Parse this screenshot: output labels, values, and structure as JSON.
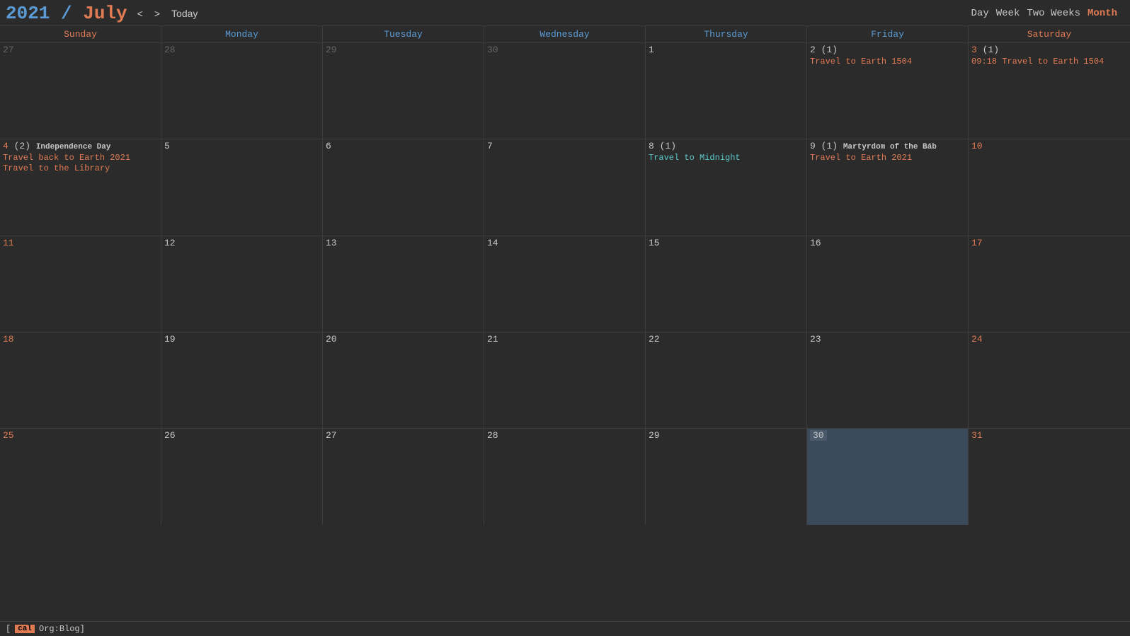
{
  "header": {
    "year": "2021",
    "sep": " / ",
    "month": "July",
    "nav": {
      "prev": "<",
      "next": ">",
      "today": "Today"
    },
    "views": [
      "Day",
      "Week",
      "Two Weeks",
      "Month"
    ],
    "active_view": "Month"
  },
  "day_headers": [
    {
      "label": "Sunday",
      "type": "weekend"
    },
    {
      "label": "Monday",
      "type": "weekday"
    },
    {
      "label": "Tuesday",
      "type": "weekday"
    },
    {
      "label": "Wednesday",
      "type": "weekday"
    },
    {
      "label": "Thursday",
      "type": "weekday"
    },
    {
      "label": "Friday",
      "type": "weekday"
    },
    {
      "label": "Saturday",
      "type": "weekend"
    }
  ],
  "weeks": [
    {
      "days": [
        {
          "date": "27",
          "type": "other-month",
          "events": []
        },
        {
          "date": "28",
          "type": "other-month",
          "events": []
        },
        {
          "date": "29",
          "type": "other-month",
          "events": []
        },
        {
          "date": "30",
          "type": "other-month",
          "events": []
        },
        {
          "date": "1",
          "type": "normal",
          "events": []
        },
        {
          "date": "2",
          "type": "normal",
          "count": "(1)",
          "events": [
            {
              "text": "Travel to Earth 1504",
              "class": "event-orange"
            }
          ]
        },
        {
          "date": "3",
          "type": "saturday",
          "count": "(1)",
          "events": [
            {
              "text": "09:18 Travel to Earth 1504",
              "class": "event-orange"
            }
          ]
        }
      ]
    },
    {
      "days": [
        {
          "date": "4",
          "type": "sunday",
          "count": "(2)",
          "label": "Independence Day",
          "events": [
            {
              "text": "Travel back to Earth 2021",
              "class": "event-orange"
            },
            {
              "text": "Travel to the Library",
              "class": "event-orange"
            }
          ]
        },
        {
          "date": "5",
          "type": "normal",
          "events": []
        },
        {
          "date": "6",
          "type": "normal",
          "events": []
        },
        {
          "date": "7",
          "type": "normal",
          "events": []
        },
        {
          "date": "8",
          "type": "normal",
          "count": "(1)",
          "events": [
            {
              "text": "Travel to Midnight",
              "class": "event-cyan"
            }
          ]
        },
        {
          "date": "9",
          "type": "normal",
          "count": "(1)",
          "label": "Martyrdom of the Báb",
          "events": [
            {
              "text": "Travel to Earth 2021",
              "class": "event-orange"
            }
          ]
        },
        {
          "date": "10",
          "type": "saturday",
          "events": []
        }
      ]
    },
    {
      "days": [
        {
          "date": "11",
          "type": "sunday",
          "events": []
        },
        {
          "date": "12",
          "type": "normal",
          "events": []
        },
        {
          "date": "13",
          "type": "normal",
          "events": []
        },
        {
          "date": "14",
          "type": "normal",
          "events": []
        },
        {
          "date": "15",
          "type": "normal",
          "events": []
        },
        {
          "date": "16",
          "type": "normal",
          "events": []
        },
        {
          "date": "17",
          "type": "saturday",
          "events": []
        }
      ]
    },
    {
      "days": [
        {
          "date": "18",
          "type": "sunday",
          "events": []
        },
        {
          "date": "19",
          "type": "normal",
          "events": []
        },
        {
          "date": "20",
          "type": "normal",
          "events": []
        },
        {
          "date": "21",
          "type": "normal",
          "events": []
        },
        {
          "date": "22",
          "type": "normal",
          "events": []
        },
        {
          "date": "23",
          "type": "normal",
          "events": []
        },
        {
          "date": "24",
          "type": "saturday",
          "events": []
        }
      ]
    },
    {
      "days": [
        {
          "date": "25",
          "type": "sunday",
          "events": []
        },
        {
          "date": "26",
          "type": "normal",
          "events": []
        },
        {
          "date": "27",
          "type": "normal",
          "events": []
        },
        {
          "date": "28",
          "type": "normal",
          "events": []
        },
        {
          "date": "29",
          "type": "normal",
          "events": []
        },
        {
          "date": "30",
          "type": "today",
          "events": []
        },
        {
          "date": "31",
          "type": "saturday",
          "events": []
        }
      ]
    }
  ],
  "footer": {
    "tag": "cal",
    "label": "Org:Blog]"
  }
}
